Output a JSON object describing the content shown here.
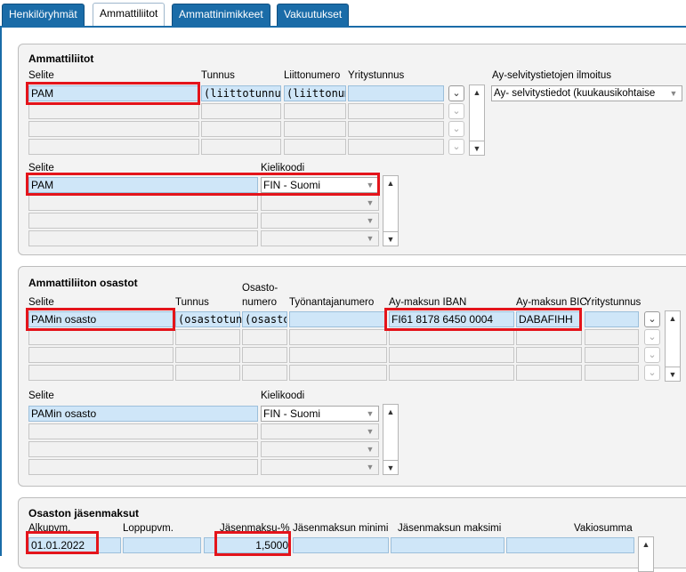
{
  "tabs": [
    {
      "label": "Henkilöryhmät"
    },
    {
      "label": "Ammattiliitot"
    },
    {
      "label": "Ammattinimikkeet"
    },
    {
      "label": "Vakuutukset"
    }
  ],
  "ammattiliitot": {
    "title": "Ammattiliitot",
    "headers": {
      "selite": "Selite",
      "tunnus": "Tunnus",
      "liittonumero": "Liittonumero",
      "yritystunnus": "Yritystunnus",
      "ilmoitus": "Ay-selvitystietojen ilmoitus"
    },
    "row1": {
      "selite": "PAM",
      "tunnus": "(liittotunnus)",
      "liittonumero": "(liittonumero)"
    },
    "ilmoitus_value": "Ay- selvitystiedot (kuukausikohtaise",
    "lang_headers": {
      "selite": "Selite",
      "kielikoodi": "Kielikoodi"
    },
    "lang_row1": {
      "selite": "PAM",
      "kielikoodi": "FIN - Suomi"
    }
  },
  "osastot": {
    "title": "Ammattiliiton osastot",
    "headers": {
      "selite": "Selite",
      "tunnus": "Tunnus",
      "osasto1": "Osasto-",
      "osasto2": "numero",
      "tyonantaja": "Työnantajanumero",
      "iban": "Ay-maksun IBAN",
      "bic": "Ay-maksun BIC",
      "yritystunnus": "Yritystunnus"
    },
    "row1": {
      "selite": "PAMin osasto",
      "tunnus": "(osastotunnus)",
      "osastonro": "(osastonro)",
      "iban": "FI61 8178 6450 0004",
      "bic": "DABAFIHH"
    },
    "lang_headers": {
      "selite": "Selite",
      "kielikoodi": "Kielikoodi"
    },
    "lang_row1": {
      "selite": "PAMin osasto",
      "kielikoodi": "FIN - Suomi"
    }
  },
  "jasenmaksut": {
    "title": "Osaston jäsenmaksut",
    "headers": {
      "alkupvm": "Alkupvm.",
      "loppupvm": "Loppupvm.",
      "pct": "Jäsenmaksu-%",
      "minimi": "Jäsenmaksun minimi",
      "maksimi": "Jäsenmaksun maksimi",
      "vakio": "Vakiosumma"
    },
    "row1": {
      "alkupvm": "01.01.2022",
      "pct": "1,5000"
    }
  },
  "icons": {
    "chevron": "chevron-down-icon",
    "up": "arrow-up-icon",
    "down": "arrow-down-icon"
  },
  "colors": {
    "tab_blue": "#1a6ca8",
    "highlight": "#e4141b",
    "field_blue": "#cfe6f8"
  }
}
